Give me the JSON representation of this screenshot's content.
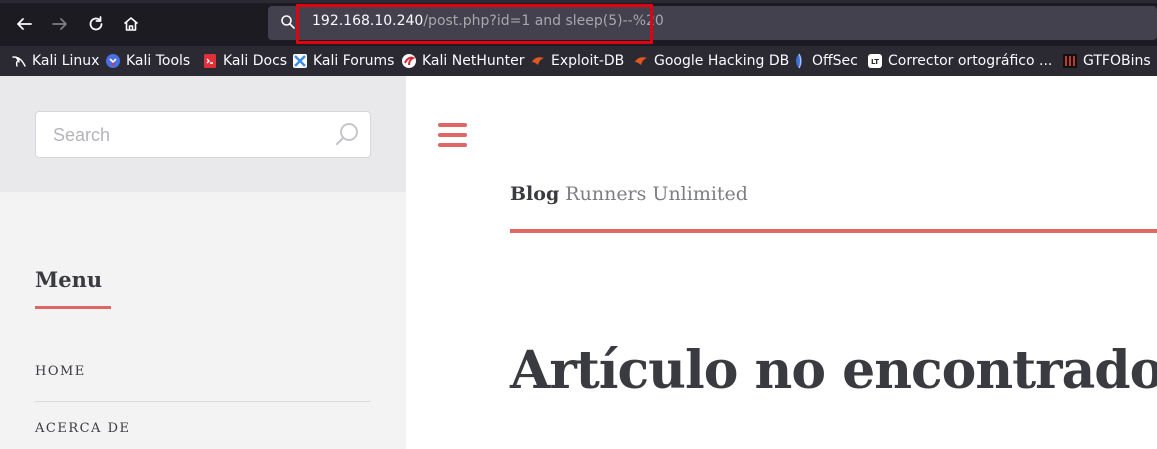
{
  "browser": {
    "url_host": "192.168.10.240",
    "url_path": "/post.php?id=1 and sleep(5)--%20",
    "icons": [
      "back-arrow-icon",
      "forward-arrow-icon",
      "reload-icon",
      "home-icon",
      "search-icon"
    ]
  },
  "bookmarks": [
    {
      "label": "Kali Linux",
      "icon": "kali-dragon-icon",
      "color": "#ffffff"
    },
    {
      "label": "Kali Tools",
      "icon": "kali-tools-icon",
      "color": "#4a6fe0"
    },
    {
      "label": "Kali Docs",
      "icon": "kali-docs-icon",
      "color": "#e0303a"
    },
    {
      "label": "Kali Forums",
      "icon": "kali-forums-icon",
      "color": "#3a8ee6"
    },
    {
      "label": "Kali NetHunter",
      "icon": "nethunter-icon",
      "color": "#d8262f"
    },
    {
      "label": "Exploit-DB",
      "icon": "exploit-db-icon",
      "color": "#e2571e"
    },
    {
      "label": "Google Hacking DB",
      "icon": "ghdb-icon",
      "color": "#e2571e"
    },
    {
      "label": "OffSec",
      "icon": "offsec-icon",
      "color": "#3b6fd1"
    },
    {
      "label": "Corrector ortográfico ...",
      "icon": "lt-icon",
      "color": "#ffffff"
    },
    {
      "label": "GTFOBins",
      "icon": "gtfobins-icon",
      "color": "#c0392b"
    }
  ],
  "sidebar": {
    "search_placeholder": "Search",
    "menu_title": "Menu",
    "menu_items": [
      "HOME",
      "ACERCA DE"
    ]
  },
  "main": {
    "blog_bold": "Blog",
    "blog_name": "Runners Unlimited",
    "headline": "Artículo no encontrado."
  },
  "colors": {
    "accent": "#e06666",
    "highlight_box": "#e3000f",
    "toolbar_bg": "#1c1b22",
    "bookmarks_bg": "#2b2a33"
  }
}
